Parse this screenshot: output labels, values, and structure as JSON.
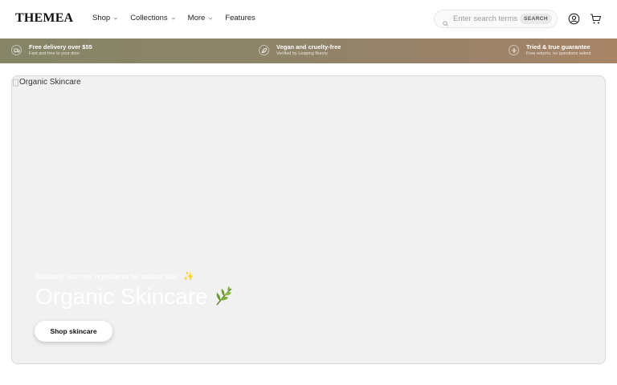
{
  "header": {
    "logo": "THEMEA",
    "nav": [
      {
        "label": "Shop",
        "has_dropdown": true
      },
      {
        "label": "Collections",
        "has_dropdown": true
      },
      {
        "label": "More",
        "has_dropdown": true
      },
      {
        "label": "Features",
        "has_dropdown": false
      }
    ],
    "search": {
      "placeholder": "Enter search terms",
      "value": "",
      "button_label": "SEARCH",
      "icon": "search-icon"
    },
    "icons": [
      "account-icon",
      "cart-icon"
    ]
  },
  "benefits": [
    {
      "title": "Free delivery over $55",
      "subtitle": "Fast and free to your door",
      "icon": "delivery-truck-icon"
    },
    {
      "title": "Vegan and cruelty-free",
      "subtitle": "Verified by Leaping Bunny",
      "icon": "leaf-icon"
    },
    {
      "title": "Tried & true guarantee",
      "subtitle": "Free returns, no questions asked",
      "icon": "sparkle-icon"
    }
  ],
  "hero": {
    "image_alt": "Organic Skincare",
    "eyebrow": "Naturally sourced ingredients for radiant skin",
    "eyebrow_icon": "✨",
    "title": "Organic Skincare",
    "title_icon": "🌿",
    "button_label": "Shop skincare"
  },
  "colors": {
    "bar_start": "#868568",
    "bar_end": "#a88567",
    "hero_bg": "#f1f1f1",
    "text": "#1a1a1a"
  }
}
